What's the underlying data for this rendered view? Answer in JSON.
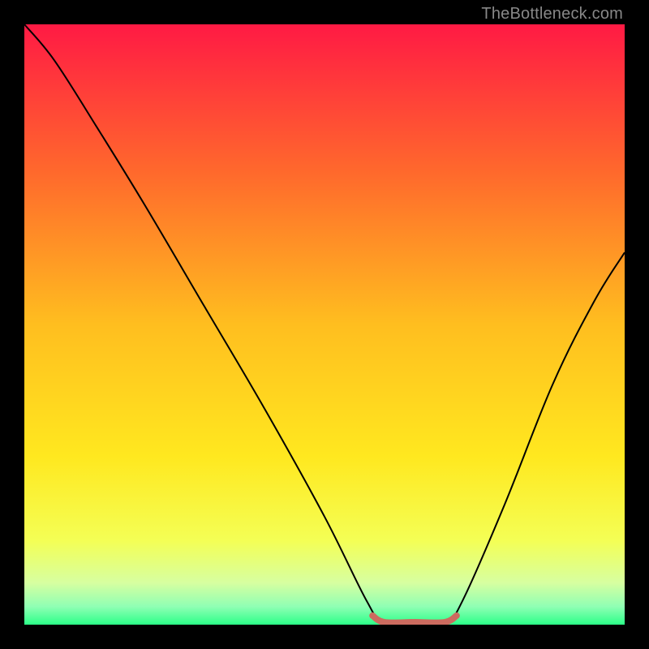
{
  "watermark": "TheBottleneck.com",
  "chart_data": {
    "type": "line",
    "title": "",
    "xlabel": "",
    "ylabel": "",
    "xlim": [
      0,
      100
    ],
    "ylim": [
      0,
      100
    ],
    "grid": false,
    "legend": false,
    "background_gradient": {
      "stops": [
        {
          "offset": 0.0,
          "color": "#ff1a44"
        },
        {
          "offset": 0.25,
          "color": "#ff6a2c"
        },
        {
          "offset": 0.5,
          "color": "#ffbe1f"
        },
        {
          "offset": 0.72,
          "color": "#ffe81f"
        },
        {
          "offset": 0.86,
          "color": "#f4ff55"
        },
        {
          "offset": 0.93,
          "color": "#d7ffa0"
        },
        {
          "offset": 0.97,
          "color": "#8fffb4"
        },
        {
          "offset": 1.0,
          "color": "#2cff88"
        }
      ]
    },
    "series": [
      {
        "name": "bottleneck-curve",
        "color": "#000000",
        "points": [
          {
            "x": 0,
            "y": 100
          },
          {
            "x": 5,
            "y": 94
          },
          {
            "x": 12,
            "y": 83
          },
          {
            "x": 20,
            "y": 70
          },
          {
            "x": 30,
            "y": 53
          },
          {
            "x": 40,
            "y": 36
          },
          {
            "x": 50,
            "y": 18
          },
          {
            "x": 57,
            "y": 4
          },
          {
            "x": 60,
            "y": 0
          },
          {
            "x": 65,
            "y": 0
          },
          {
            "x": 70,
            "y": 0
          },
          {
            "x": 73,
            "y": 4
          },
          {
            "x": 80,
            "y": 20
          },
          {
            "x": 88,
            "y": 40
          },
          {
            "x": 95,
            "y": 54
          },
          {
            "x": 100,
            "y": 62
          }
        ]
      },
      {
        "name": "flat-marker",
        "color": "#cc6b5f",
        "stroke_width": 8,
        "points": [
          {
            "x": 58,
            "y": 1.5
          },
          {
            "x": 60,
            "y": 0.4
          },
          {
            "x": 65,
            "y": 0.4
          },
          {
            "x": 70,
            "y": 0.4
          },
          {
            "x": 72,
            "y": 1.5
          }
        ]
      }
    ]
  }
}
